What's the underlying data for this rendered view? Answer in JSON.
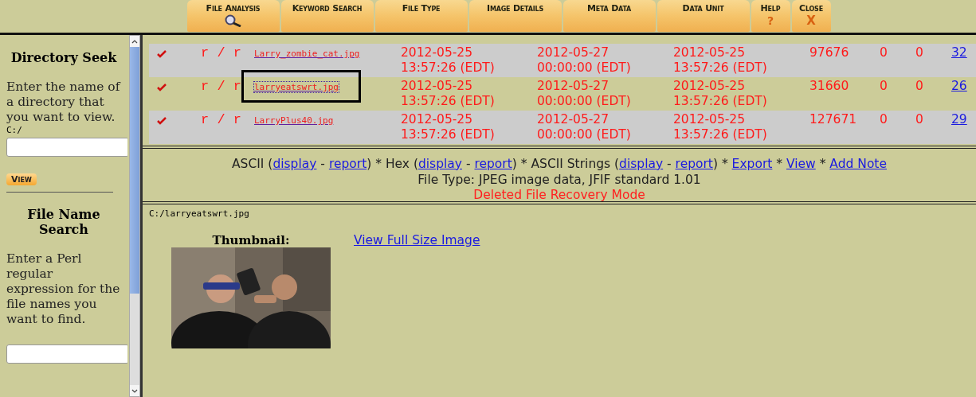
{
  "nav": [
    {
      "label": "File Analysis",
      "kind": "search"
    },
    {
      "label": "Keyword Search",
      "kind": "plain"
    },
    {
      "label": "File Type",
      "kind": "plain"
    },
    {
      "label": "Image Details",
      "kind": "plain"
    },
    {
      "label": "Meta Data",
      "kind": "plain"
    },
    {
      "label": "Data Unit",
      "kind": "plain"
    },
    {
      "label": "Help",
      "kind": "help",
      "glyph": "?"
    },
    {
      "label": "Close",
      "kind": "close",
      "glyph": "X"
    }
  ],
  "sidebar": {
    "directory_seek": {
      "title": "Directory Seek",
      "text": "Enter the name of a directory that you want to view.",
      "path": "C:/",
      "button": "View"
    },
    "file_name_search": {
      "title": "File Name Search",
      "text": "Enter a Perl regular expression for the file names you want to find."
    }
  },
  "files": [
    {
      "type": "r / r",
      "name": "Larry_zombie_cat.jpg",
      "written": [
        "2012-05-25",
        "13:57:26 (EDT)"
      ],
      "accessed": [
        "2012-05-27",
        "00:00:00 (EDT)"
      ],
      "created": [
        "2012-05-25",
        "13:57:26 (EDT)"
      ],
      "size": "97676",
      "uid": "0",
      "gid": "0",
      "meta": "32",
      "selected": false
    },
    {
      "type": "r / r",
      "name": "larryeatswrt.jpg",
      "written": [
        "2012-05-25",
        "13:57:26 (EDT)"
      ],
      "accessed": [
        "2012-05-27",
        "00:00:00 (EDT)"
      ],
      "created": [
        "2012-05-25",
        "13:57:26 (EDT)"
      ],
      "size": "31660",
      "uid": "0",
      "gid": "0",
      "meta": "26",
      "selected": true
    },
    {
      "type": "r / r",
      "name": "LarryPlus40.jpg",
      "written": [
        "2012-05-25",
        "13:57:26 (EDT)"
      ],
      "accessed": [
        "2012-05-27",
        "00:00:00 (EDT)"
      ],
      "created": [
        "2012-05-25",
        "13:57:26 (EDT)"
      ],
      "size": "127671",
      "uid": "0",
      "gid": "0",
      "meta": "29",
      "selected": false
    }
  ],
  "actions": [
    {
      "kind": "text",
      "text": "ASCII ("
    },
    {
      "kind": "link",
      "text": "display"
    },
    {
      "kind": "text",
      "text": " - "
    },
    {
      "kind": "link",
      "text": "report"
    },
    {
      "kind": "text",
      "text": ") * Hex ("
    },
    {
      "kind": "link",
      "text": "display"
    },
    {
      "kind": "text",
      "text": " - "
    },
    {
      "kind": "link",
      "text": "report"
    },
    {
      "kind": "text",
      "text": ") * ASCII Strings ("
    },
    {
      "kind": "link",
      "text": "display"
    },
    {
      "kind": "text",
      "text": " - "
    },
    {
      "kind": "link",
      "text": "report"
    },
    {
      "kind": "text",
      "text": ") * "
    },
    {
      "kind": "link",
      "text": "Export"
    },
    {
      "kind": "text",
      "text": " * "
    },
    {
      "kind": "link",
      "text": "View"
    },
    {
      "kind": "text",
      "text": " * "
    },
    {
      "kind": "link",
      "text": "Add Note"
    }
  ],
  "file_type": "File Type: JPEG image data, JFIF standard 1.01",
  "mode": "Deleted File Recovery Mode",
  "viewer": {
    "path": "C:/larryeatswrt.jpg",
    "thumbnail_label": "Thumbnail:",
    "full_size_link": "View Full Size Image"
  }
}
